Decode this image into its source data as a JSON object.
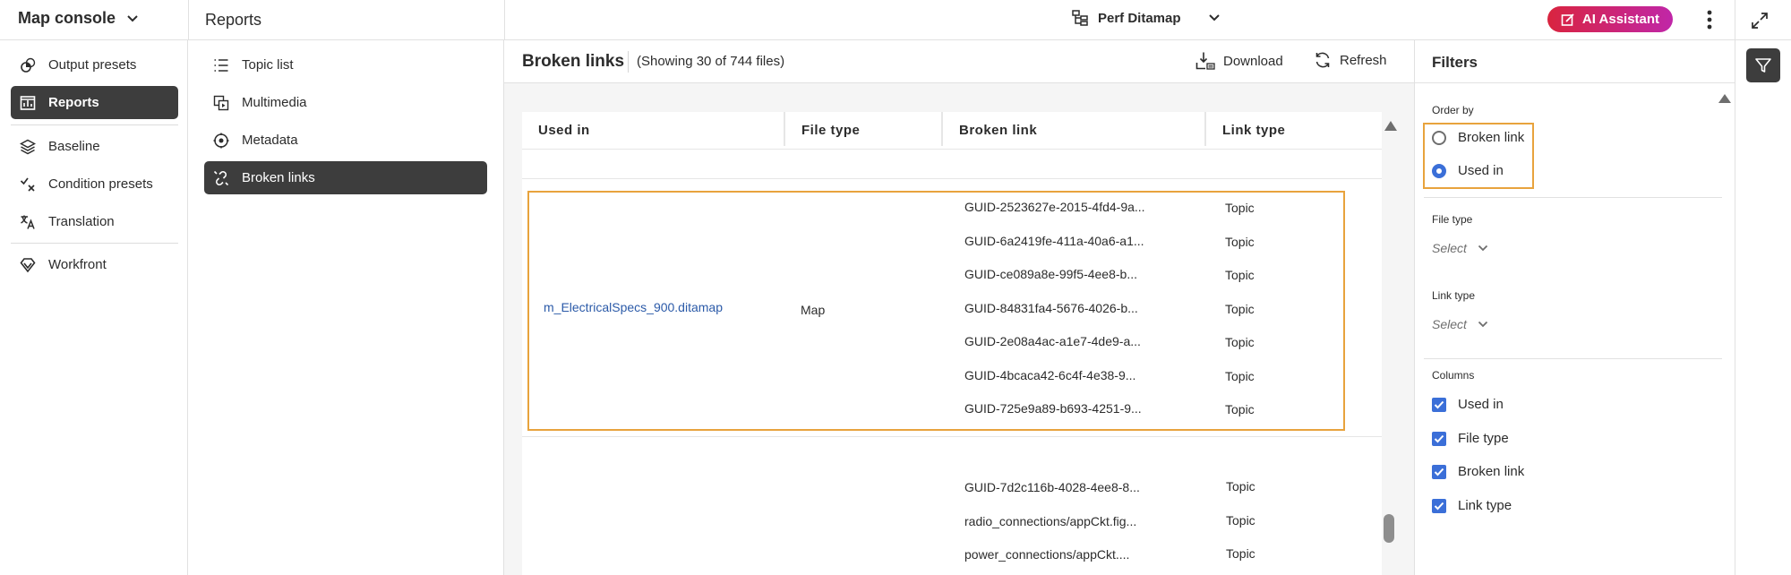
{
  "header": {
    "console_title": "Map console",
    "section_title": "Reports",
    "ditamap_name": "Perf Ditamap",
    "ai_assistant_label": "AI Assistant"
  },
  "leftnav": {
    "items": [
      {
        "label": "Output presets",
        "icon": "output-presets-icon"
      },
      {
        "label": "Reports",
        "icon": "reports-icon",
        "active": true
      },
      {
        "label": "Baseline",
        "icon": "baseline-layers-icon"
      },
      {
        "label": "Condition presets",
        "icon": "condition-presets-icon"
      },
      {
        "label": "Translation",
        "icon": "translation-icon"
      },
      {
        "label": "Workfront",
        "icon": "workfront-icon"
      }
    ]
  },
  "subnav": {
    "items": [
      {
        "label": "Topic list",
        "icon": "list-icon"
      },
      {
        "label": "Multimedia",
        "icon": "multimedia-icon"
      },
      {
        "label": "Metadata",
        "icon": "metadata-icon"
      },
      {
        "label": "Broken links",
        "icon": "broken-link-icon",
        "active": true
      }
    ]
  },
  "main": {
    "title": "Broken links",
    "showing": "(Showing 30 of 744 files)",
    "download_label": "Download",
    "refresh_label": "Refresh",
    "columns": [
      "Used in",
      "File type",
      "Broken link",
      "Link type"
    ],
    "group1": {
      "used_in": "m_ElectricalSpecs_900.ditamap",
      "file_type": "Map",
      "links": [
        {
          "broken_link": "GUID-2523627e-2015-4fd4-9a...",
          "link_type": "Topic"
        },
        {
          "broken_link": "GUID-6a2419fe-411a-40a6-a1...",
          "link_type": "Topic"
        },
        {
          "broken_link": "GUID-ce089a8e-99f5-4ee8-b...",
          "link_type": "Topic"
        },
        {
          "broken_link": "GUID-84831fa4-5676-4026-b...",
          "link_type": "Topic"
        },
        {
          "broken_link": "GUID-2e08a4ac-a1e7-4de9-a...",
          "link_type": "Topic"
        },
        {
          "broken_link": "GUID-4bcaca42-6c4f-4e38-9...",
          "link_type": "Topic"
        },
        {
          "broken_link": "GUID-725e9a89-b693-4251-9...",
          "link_type": "Topic"
        }
      ]
    },
    "group2": {
      "links": [
        {
          "broken_link": "GUID-7d2c116b-4028-4ee8-8...",
          "link_type": "Topic"
        },
        {
          "broken_link": "radio_connections/appCkt.fig...",
          "link_type": "Topic"
        },
        {
          "broken_link": "power_connections/appCkt....",
          "link_type": "Topic"
        }
      ]
    }
  },
  "filters": {
    "title": "Filters",
    "order_by_label": "Order by",
    "order_options": [
      {
        "label": "Broken link",
        "selected": false
      },
      {
        "label": "Used in",
        "selected": true
      }
    ],
    "file_type_label": "File type",
    "file_type_placeholder": "Select",
    "link_type_label": "Link type",
    "link_type_placeholder": "Select",
    "columns_label": "Columns",
    "columns": [
      {
        "label": "Used in",
        "checked": true
      },
      {
        "label": "File type",
        "checked": true
      },
      {
        "label": "Broken link",
        "checked": true
      },
      {
        "label": "Link type",
        "checked": true
      }
    ]
  },
  "colors": {
    "accent": "#3b6fd8",
    "highlight": "#e8a33d",
    "active_nav": "#3d3d3d",
    "link": "#2b5aa8"
  }
}
